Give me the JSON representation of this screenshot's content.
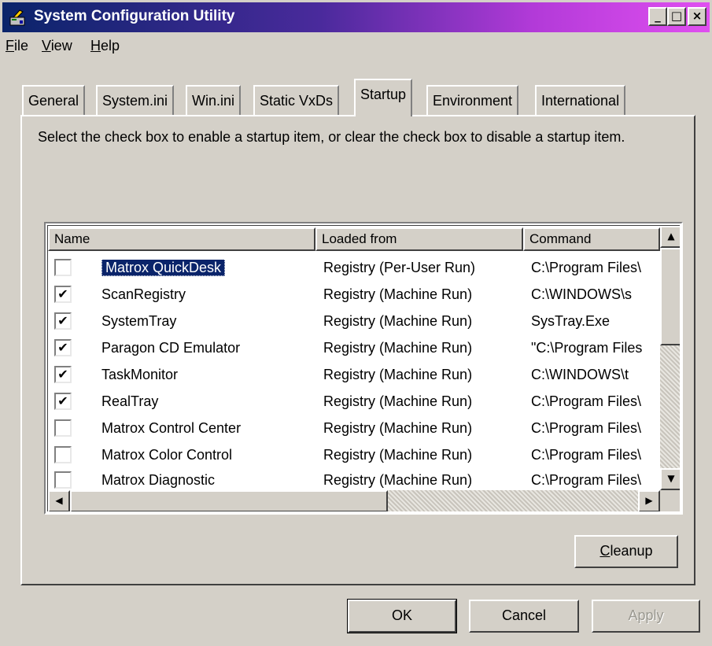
{
  "window": {
    "title": "System Configuration Utility",
    "controls": {
      "minimize": "_",
      "maximize": "□",
      "close": "×"
    }
  },
  "menu": [
    {
      "label": "File",
      "accel": "F",
      "rest": "ile"
    },
    {
      "label": "View",
      "accel": "V",
      "rest": "iew"
    },
    {
      "label": "Help",
      "accel": "H",
      "rest": "elp"
    }
  ],
  "tabs": [
    {
      "label": "General"
    },
    {
      "label": "System.ini"
    },
    {
      "label": "Win.ini"
    },
    {
      "label": "Static VxDs"
    },
    {
      "label": "Startup",
      "active": true
    },
    {
      "label": "Environment"
    },
    {
      "label": "International"
    }
  ],
  "startup": {
    "description": "Select the check box to enable a startup item, or clear the check box to disable a startup item.",
    "columns": {
      "name": "Name",
      "loaded_from": "Loaded from",
      "command": "Command"
    },
    "items": [
      {
        "checked": false,
        "name": "Matrox QuickDesk",
        "loaded_from": "Registry (Per-User Run)",
        "command": "C:\\Program Files\\",
        "selected": true
      },
      {
        "checked": true,
        "name": "ScanRegistry",
        "loaded_from": "Registry (Machine Run)",
        "command": "C:\\WINDOWS\\s"
      },
      {
        "checked": true,
        "name": "SystemTray",
        "loaded_from": "Registry (Machine Run)",
        "command": "SysTray.Exe"
      },
      {
        "checked": true,
        "name": "Paragon CD Emulator",
        "loaded_from": "Registry (Machine Run)",
        "command": "\"C:\\Program Files"
      },
      {
        "checked": true,
        "name": "TaskMonitor",
        "loaded_from": "Registry (Machine Run)",
        "command": "C:\\WINDOWS\\t"
      },
      {
        "checked": true,
        "name": "RealTray",
        "loaded_from": "Registry (Machine Run)",
        "command": "C:\\Program Files\\"
      },
      {
        "checked": false,
        "name": "Matrox Control Center",
        "loaded_from": "Registry (Machine Run)",
        "command": "C:\\Program Files\\"
      },
      {
        "checked": false,
        "name": "Matrox Color Control",
        "loaded_from": "Registry (Machine Run)",
        "command": "C:\\Program Files\\"
      },
      {
        "checked": false,
        "name": "Matrox Diagnostic",
        "loaded_from": "Registry (Machine Run)",
        "command": "C:\\Program Files\\"
      }
    ],
    "cleanup": {
      "label": "Cleanup",
      "accel": "C",
      "rest": "leanup"
    }
  },
  "buttons": {
    "ok": "OK",
    "cancel": "Cancel",
    "apply": "Apply",
    "apply_enabled": false
  }
}
